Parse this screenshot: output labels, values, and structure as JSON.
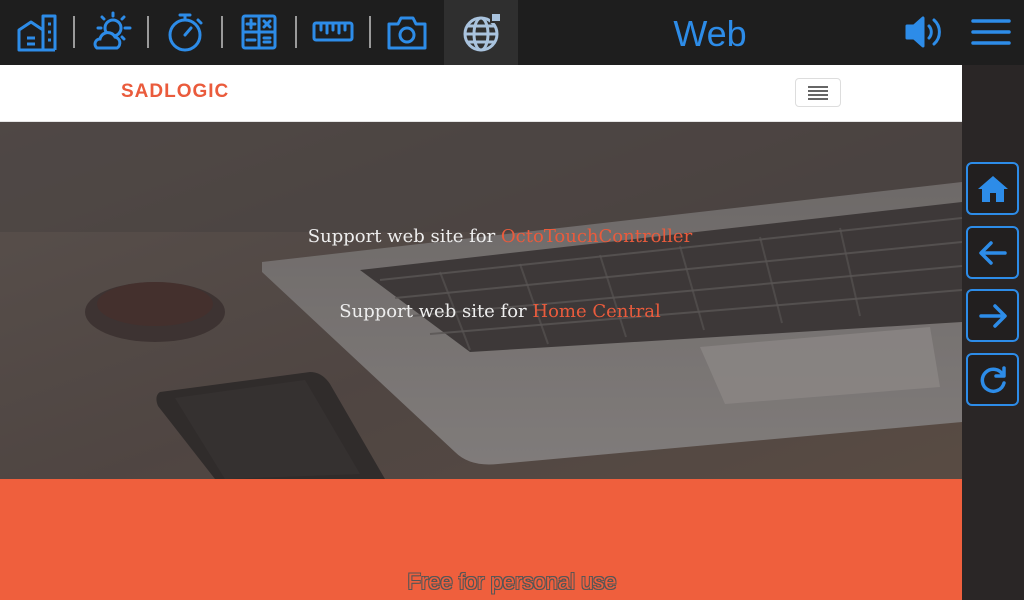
{
  "topbar": {
    "title": "Web",
    "icons": [
      "home-icon",
      "weather-icon",
      "timer-icon",
      "calculator-icon",
      "ruler-icon",
      "camera-icon",
      "globe-icon"
    ],
    "active": "globe-icon",
    "volume_icon": "speaker-icon",
    "menu_icon": "hamburger-icon",
    "accent_color": "#2d8ce8"
  },
  "site": {
    "brand": "SADLOGIC",
    "brand_color": "#ea5b3c",
    "hero": {
      "line1_prefix": "Support web site for ",
      "line1_link": "OctoTouchController",
      "line2_prefix": "Support web site for ",
      "line2_link": "Home Central"
    },
    "band_text": "Free for personal use",
    "band_color": "#ef5f3d"
  },
  "side_panel": {
    "buttons": [
      "home-icon",
      "back-arrow-icon",
      "forward-arrow-icon",
      "reload-icon"
    ]
  }
}
